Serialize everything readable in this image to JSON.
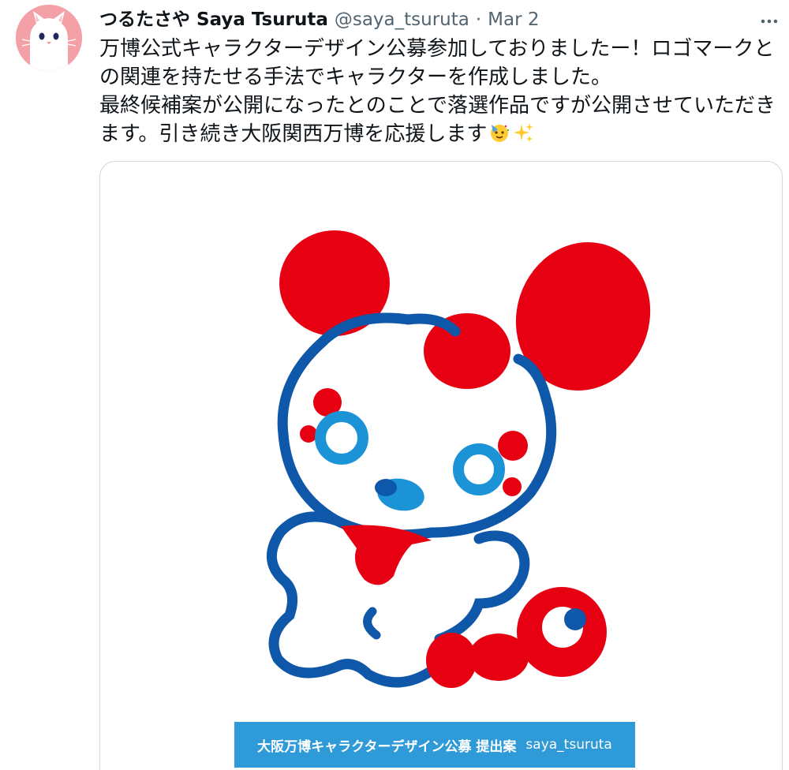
{
  "tweet": {
    "display_name": "つるたさや Saya Tsuruta",
    "handle": "@saya_tsuruta",
    "separator": "·",
    "date": "Mar 2",
    "text_lines": [
      "万博公式キャラクターデザイン公募参加しておりましたー！ロゴマークと",
      "の関連を持たせる手法でキャラクターを作成しました。",
      "最終候補案が公開になったとのことで落選作品ですが公開させていただき",
      "ます。引き続き大阪関西万博を応援します"
    ],
    "emojis": [
      "partying-face-emoji",
      "sparkles-emoji"
    ]
  },
  "media": {
    "caption_main": "大阪万博キャラクターデザイン公募 提出案",
    "caption_id": "saya_tsuruta"
  },
  "icons": {
    "more": "more-horizontal-icon",
    "avatar": "white-cat-avatar"
  },
  "colors": {
    "accent_red": "#e60012",
    "accent_blue": "#0f57a8",
    "light_blue": "#1b93d6",
    "caption_bg": "#2e9ad8",
    "avatar_bg": "#f4a0a7"
  }
}
